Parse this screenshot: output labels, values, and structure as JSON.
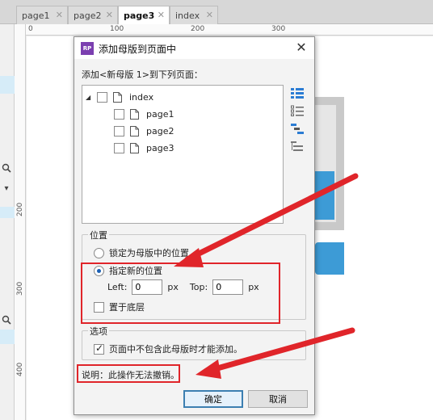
{
  "editor": {
    "tabs": [
      {
        "label": "page1",
        "close": "✕"
      },
      {
        "label": "page2",
        "close": "✕"
      },
      {
        "label": "page3",
        "close": "✕"
      },
      {
        "label": "index",
        "close": "✕"
      }
    ],
    "hruler_ticks": [
      "0",
      "100",
      "200",
      "300"
    ],
    "vruler_ticks": [
      "200",
      "300",
      "400"
    ]
  },
  "dialog": {
    "title": "添加母版到页面中",
    "close_glyph": "✕",
    "app_icon_text": "RP",
    "prompt": "添加<新母版 1>到下列页面：",
    "tree": [
      {
        "label": "index",
        "level": 0,
        "expander": "◢"
      },
      {
        "label": "page1",
        "level": 1
      },
      {
        "label": "page2",
        "level": 1
      },
      {
        "label": "page3",
        "level": 1
      }
    ],
    "position_group": {
      "legend": "位置",
      "option_lock": "锁定为母版中的位置",
      "option_new": "指定新的位置",
      "left_label": "Left:",
      "left_value": "0",
      "top_label": "Top:",
      "top_value": "0",
      "unit": "px",
      "bottom_label": "置于底层"
    },
    "options_group": {
      "legend": "选项",
      "only_if_absent": "页面中不包含此母版时才能添加。"
    },
    "note": "说明：此操作无法撤销。",
    "ok": "确定",
    "cancel": "取消"
  },
  "colors": {
    "annotation_red": "#e0252a",
    "accent_blue": "#3d9bd6",
    "app_icon_purple": "#7b3fb0"
  }
}
